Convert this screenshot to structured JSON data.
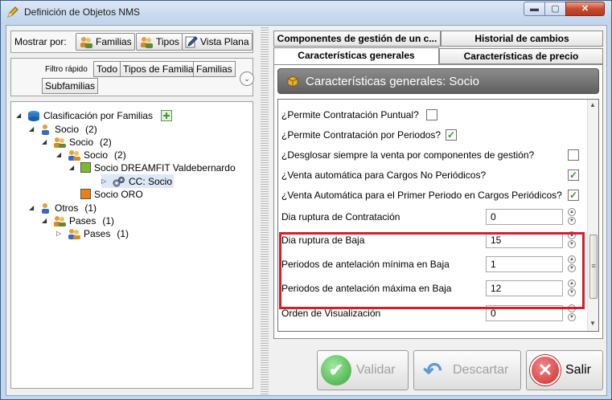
{
  "window": {
    "title": "Definición de Objetos NMS",
    "min": "▬",
    "max": "▢",
    "close": "✕"
  },
  "left": {
    "mostrar_label": "Mostrar por:",
    "buttons": [
      "Familias",
      "Tipos",
      "Vista Plana"
    ],
    "filtro_label": "Filtro rápido",
    "filters": [
      "Todo",
      "Tipos de Familia",
      "Familias",
      "Subfamilias"
    ],
    "expand_glyph": "⌄",
    "tree": {
      "root": "Clasificación por Familias",
      "socio1": {
        "label": "Socio",
        "count": "(2)"
      },
      "socio2": {
        "label": "Socio",
        "count": "(2)"
      },
      "socio3": {
        "label": "Socio",
        "count": "(2)"
      },
      "dreamfit": {
        "label": "Socio DREAMFIT Valdebernardo"
      },
      "cc": {
        "label": "CC: Socio"
      },
      "oro": {
        "label": "Socio ORO"
      },
      "otros": {
        "label": "Otros",
        "count": "(1)"
      },
      "pases1": {
        "label": "Pases",
        "count": "(1)"
      },
      "pases2": {
        "label": "Pases",
        "count": "(1)"
      }
    }
  },
  "tabs": {
    "componentes": "Componentes de gestión de un c...",
    "historial": "Historial de cambios",
    "generales": "Características generales",
    "precio": "Características de precio"
  },
  "panel": {
    "header": "Características generales: Socio",
    "checks": [
      {
        "label": "¿Permite Contratación Puntual?",
        "checked": ""
      },
      {
        "label": "¿Permite Contratación por Periodos?",
        "checked": "✓"
      },
      {
        "label": "¿Desglosar siempre la venta por componentes de gestión?",
        "checked": ""
      },
      {
        "label": "¿Venta automática para Cargos No Periódicos?",
        "checked": "✓"
      },
      {
        "label": "¿Venta Automática para el Primer Periodo en Cargos Periódicos?",
        "checked": "✓"
      }
    ],
    "numbers": [
      {
        "label": "Dia ruptura de Contratación",
        "value": "0"
      },
      {
        "label": "Dia ruptura de Baja",
        "value": "15"
      },
      {
        "label": "Periodos de antelación mínima en Baja",
        "value": "1"
      },
      {
        "label": "Periodos de antelación máxima en Baja",
        "value": "12"
      },
      {
        "label": "Orden de Visualización",
        "value": "0"
      }
    ]
  },
  "actions": {
    "validar": "Validar",
    "descartar": "Descartar",
    "salir": "Salir"
  },
  "colors": {
    "highlight": "#d71c2a",
    "dreamfit": "#7dbb2a",
    "oro": "#f07d10"
  }
}
